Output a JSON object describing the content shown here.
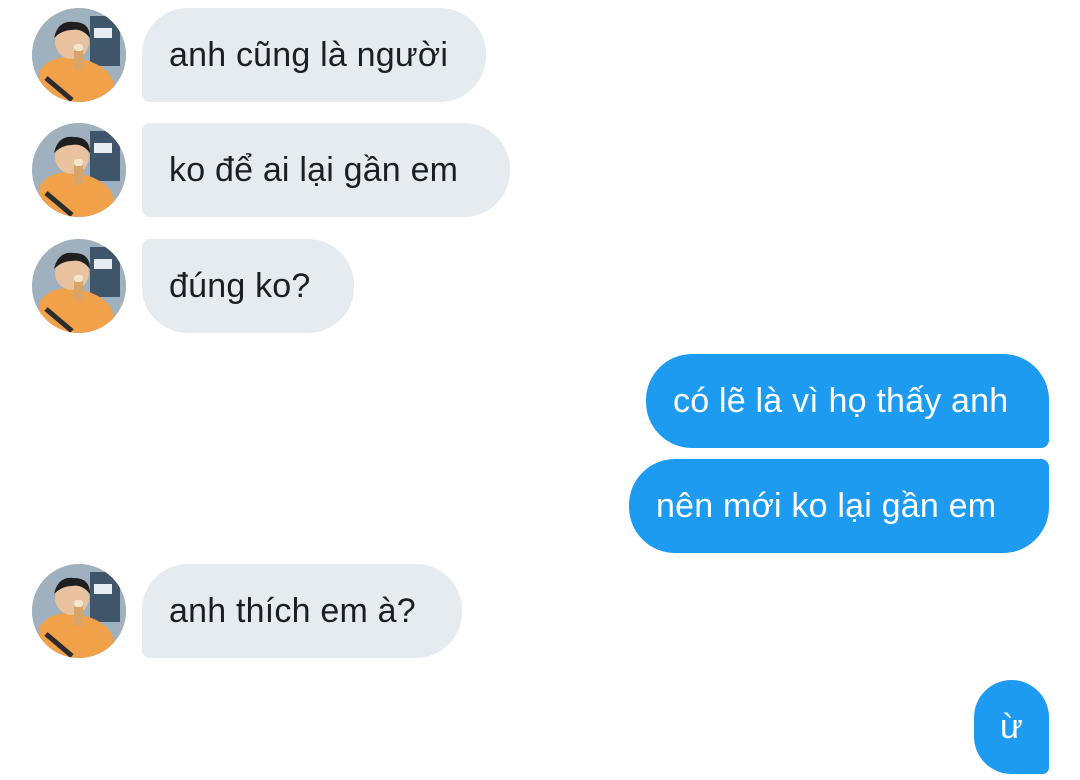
{
  "conversation": {
    "messages": [
      {
        "direction": "in",
        "text": "anh cũng là người"
      },
      {
        "direction": "in",
        "text": "ko để ai lại gần em"
      },
      {
        "direction": "in",
        "text": "đúng ko?"
      },
      {
        "direction": "out",
        "text": "có lẽ là vì họ thấy anh"
      },
      {
        "direction": "out",
        "text": "nên mới ko lại gần em"
      },
      {
        "direction": "in",
        "text": "anh thích em à?"
      },
      {
        "direction": "out",
        "text": "ừ"
      }
    ]
  },
  "colors": {
    "incoming_bubble": "#e6ebf0",
    "outgoing_bubble": "#1d9bf0",
    "incoming_text": "#1c1e21",
    "outgoing_text": "#ffffff",
    "avatar_hoodie": "#f0a14a"
  },
  "icons": {
    "sender_avatar": "avatar-photo"
  }
}
